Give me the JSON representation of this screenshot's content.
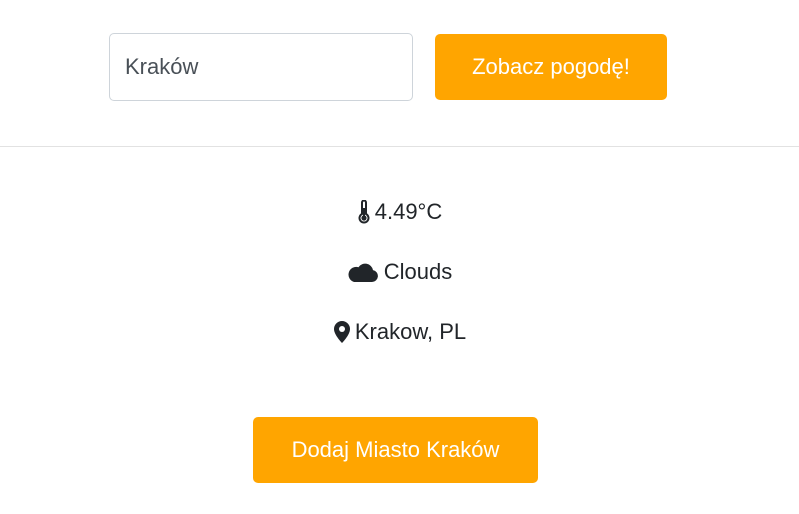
{
  "search": {
    "input_value": "Kraków",
    "placeholder": "Kraków",
    "button_label": "Zobacz pogodę!"
  },
  "weather": {
    "temperature": "4.49°C",
    "description": "Clouds",
    "location": "Krakow, PL",
    "temperature_icon": "thermometer-icon",
    "description_icon": "cloud-icon",
    "location_icon": "map-pin-icon"
  },
  "actions": {
    "add_city_label": "Dodaj Miasto Kraków"
  },
  "colors": {
    "accent": "#ffa500",
    "text": "#212529",
    "border": "#ced4da"
  }
}
